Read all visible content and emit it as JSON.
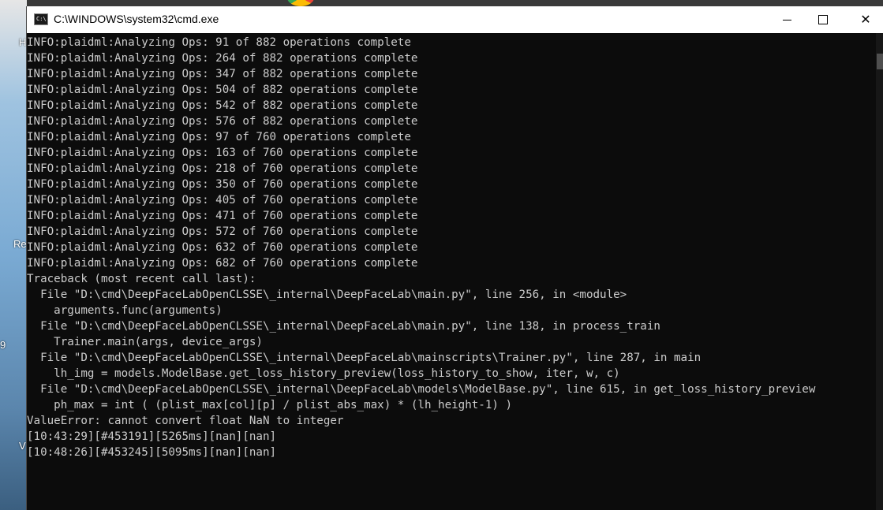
{
  "window": {
    "title": "C:\\WINDOWS\\system32\\cmd.exe",
    "app_icon_text": "C:\\"
  },
  "desktop_fragments": [
    "H",
    "Re",
    "9",
    "V"
  ],
  "console": {
    "lines": [
      "INFO:plaidml:Analyzing Ops: 91 of 882 operations complete",
      "INFO:plaidml:Analyzing Ops: 264 of 882 operations complete",
      "INFO:plaidml:Analyzing Ops: 347 of 882 operations complete",
      "INFO:plaidml:Analyzing Ops: 504 of 882 operations complete",
      "INFO:plaidml:Analyzing Ops: 542 of 882 operations complete",
      "INFO:plaidml:Analyzing Ops: 576 of 882 operations complete",
      "INFO:plaidml:Analyzing Ops: 97 of 760 operations complete",
      "INFO:plaidml:Analyzing Ops: 163 of 760 operations complete",
      "INFO:plaidml:Analyzing Ops: 218 of 760 operations complete",
      "INFO:plaidml:Analyzing Ops: 350 of 760 operations complete",
      "INFO:plaidml:Analyzing Ops: 405 of 760 operations complete",
      "INFO:plaidml:Analyzing Ops: 471 of 760 operations complete",
      "INFO:plaidml:Analyzing Ops: 572 of 760 operations complete",
      "INFO:plaidml:Analyzing Ops: 632 of 760 operations complete",
      "INFO:plaidml:Analyzing Ops: 682 of 760 operations complete",
      "Traceback (most recent call last):",
      "  File \"D:\\cmd\\DeepFaceLabOpenCLSSE\\_internal\\DeepFaceLab\\main.py\", line 256, in <module>",
      "    arguments.func(arguments)",
      "  File \"D:\\cmd\\DeepFaceLabOpenCLSSE\\_internal\\DeepFaceLab\\main.py\", line 138, in process_train",
      "    Trainer.main(args, device_args)",
      "  File \"D:\\cmd\\DeepFaceLabOpenCLSSE\\_internal\\DeepFaceLab\\mainscripts\\Trainer.py\", line 287, in main",
      "    lh_img = models.ModelBase.get_loss_history_preview(loss_history_to_show, iter, w, c)",
      "  File \"D:\\cmd\\DeepFaceLabOpenCLSSE\\_internal\\DeepFaceLab\\models\\ModelBase.py\", line 615, in get_loss_history_preview",
      "    ph_max = int ( (plist_max[col][p] / plist_abs_max) * (lh_height-1) )",
      "ValueError: cannot convert float NaN to integer",
      "[10:43:29][#453191][5265ms][nan][nan]",
      "[10:48:26][#453245][5095ms][nan][nan]"
    ]
  },
  "colors": {
    "console_bg": "#0c0c0c",
    "console_text": "#cccccc",
    "titlebar_bg": "#ffffff"
  },
  "icons": {
    "app": "cmd-app-icon",
    "minimize": "minimize-icon",
    "maximize": "maximize-icon",
    "close": "close-icon"
  }
}
